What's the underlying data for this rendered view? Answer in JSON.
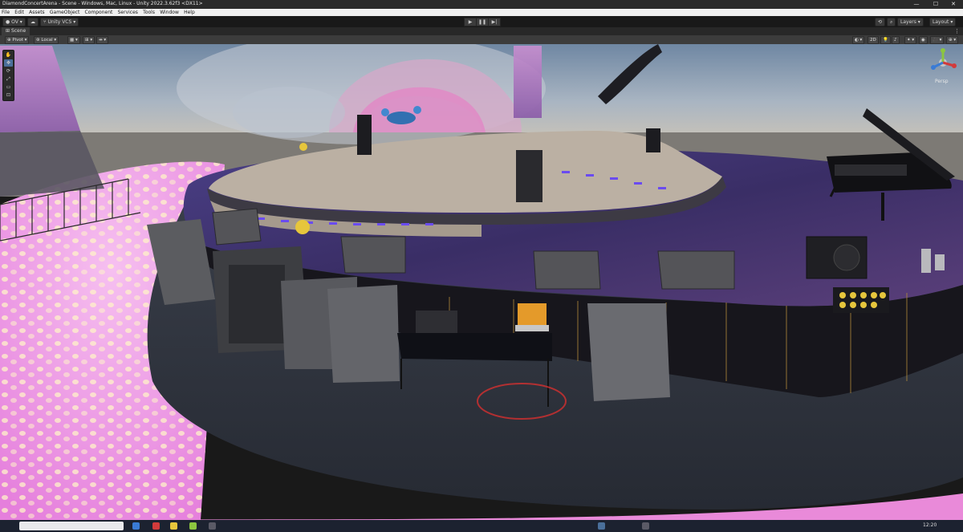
{
  "window": {
    "title": "DiamondConcertArena - Scene - Windows, Mac, Linux - Unity 2022.3.62f3 <DX11>",
    "minimize": "—",
    "maximize": "☐",
    "close": "✕"
  },
  "menu": [
    "File",
    "Edit",
    "Assets",
    "GameObject",
    "Component",
    "Services",
    "Tools",
    "Window",
    "Help"
  ],
  "toolbar": {
    "account": "OV",
    "cloud_icon": "cloud-icon",
    "version_control": "Unity VCS",
    "play": "▶",
    "pause": "❚❚",
    "step": "▶|",
    "layers": "Layers",
    "layout": "Layout"
  },
  "scene_tab": {
    "label": "Scene"
  },
  "scene_toolbar": {
    "pivot": "Pivot",
    "local": "Local",
    "mode_2d": "2D"
  },
  "gizmo": {
    "label": "Persp"
  },
  "taskbar": {
    "time": "12:20"
  },
  "colors": {
    "accent": "#4a6f9a",
    "sky": "#8ea3b8",
    "floor_pink": "#f2a0e6",
    "stage_purple": "#3a2e66"
  }
}
